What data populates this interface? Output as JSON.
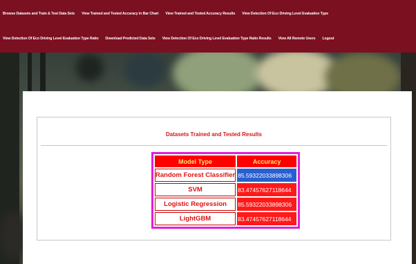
{
  "nav": {
    "row1": [
      "Browse Datasets and Train & Test Data Sets",
      "View Trained and Tested Accuracy in Bar Chart",
      "View Trained and Tested Accuracy Results",
      "View Detection Of Eco Driving Level Evaluation Type"
    ],
    "row2": [
      "View Detection Of Eco Driving Level Evaluation Type Ratio",
      "Download Predicted Data Sets",
      "View Detection Of Eco Driving Level Evaluation Type Ratio Results",
      "View All Remote Users",
      "Logout"
    ]
  },
  "section": {
    "title": "Datasets Trained and Tested Results"
  },
  "table": {
    "headers": [
      "Model Type",
      "Accuracy"
    ],
    "rows": [
      {
        "model": "Random Forest Classifier",
        "accuracy": "85.59322033898306"
      },
      {
        "model": "SVM",
        "accuracy": "83.47457627118644"
      },
      {
        "model": "Logistic Regression",
        "accuracy": "85.59322033898306"
      },
      {
        "model": "LightGBM",
        "accuracy": "83.47457627118644"
      }
    ]
  },
  "colors": {
    "navbar": "#7b1020",
    "title": "#d01818",
    "table_border": "#e11fd6",
    "header_bg": "#ff0000",
    "header_text": "#ffe36a",
    "accuracy_bg": "#ff1a1a",
    "selected_bg": "#2a5fd0"
  }
}
